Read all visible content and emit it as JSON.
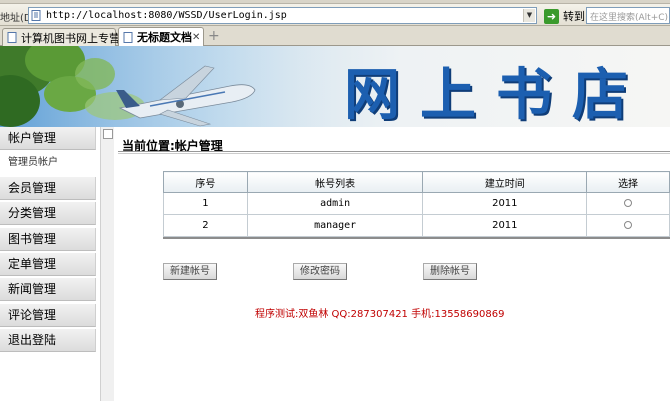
{
  "browser": {
    "address_label": "地址(D)",
    "url": "http://localhost:8080/WSSD/UserLogin.jsp",
    "go_label": "转到",
    "search_placeholder": "在这里搜索(Alt+C)",
    "tabs": [
      {
        "label": "计算机图书网上专营店",
        "active": false
      },
      {
        "label": "无标题文档",
        "active": true
      }
    ]
  },
  "banner": {
    "title": "网上书店"
  },
  "sidebar": {
    "items": [
      {
        "label": "帐户管理",
        "type": "header"
      },
      {
        "label": "管理员帐户",
        "type": "sub"
      },
      {
        "label": "会员管理",
        "type": "header"
      },
      {
        "label": "分类管理",
        "type": "header"
      },
      {
        "label": "图书管理",
        "type": "header"
      },
      {
        "label": "定单管理",
        "type": "header"
      },
      {
        "label": "新闻管理",
        "type": "header"
      },
      {
        "label": "评论管理",
        "type": "header"
      },
      {
        "label": "退出登陆",
        "type": "header"
      }
    ]
  },
  "main": {
    "location": "当前位置:帐户管理",
    "table": {
      "headers": [
        "序号",
        "帐号列表",
        "建立时间",
        "选择"
      ],
      "rows": [
        [
          "1",
          "admin",
          "2011"
        ],
        [
          "2",
          "manager",
          "2011"
        ]
      ]
    },
    "buttons": {
      "new_account": "新建帐号",
      "change_password": "修改密码",
      "delete_account": "删除帐号"
    },
    "footer": "程序测试:双鱼林 QQ:287307421 手机:13558690869"
  },
  "colors": {
    "banner_title": "#1c5fb0",
    "footer_text": "#c00000"
  }
}
